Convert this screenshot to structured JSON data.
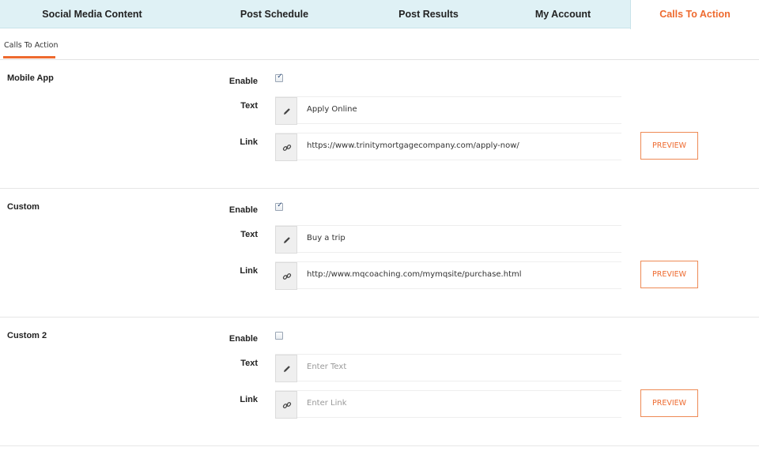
{
  "topnav": {
    "tabs": [
      {
        "label": "Social Media Content"
      },
      {
        "label": "Post Schedule"
      },
      {
        "label": "Post Results"
      },
      {
        "label": "My Account"
      },
      {
        "label": "Calls To Action"
      }
    ],
    "active_tab": "Calls To Action"
  },
  "subtabs": {
    "active": "Calls To Action"
  },
  "labels": {
    "enable": "Enable",
    "text": "Text",
    "link": "Link",
    "preview": "PREVIEW"
  },
  "sections": [
    {
      "title": "Mobile App",
      "enabled": true,
      "text_value": "Apply Online",
      "text_placeholder": "",
      "link_value": "https://www.trinitymortgagecompany.com/apply-now/",
      "link_placeholder": ""
    },
    {
      "title": "Custom",
      "enabled": true,
      "text_value": "Buy a trip",
      "text_placeholder": "",
      "link_value": "http://www.mqcoaching.com/mymqsite/purchase.html",
      "link_placeholder": ""
    },
    {
      "title": "Custom 2",
      "enabled": false,
      "text_value": "Enter Text",
      "text_placeholder": "Enter Text",
      "link_value": "Enter Link",
      "link_placeholder": "Enter Link"
    }
  ],
  "icons": {
    "text_field": "pencil-icon",
    "link_field": "link-icon"
  },
  "colors": {
    "accent": "#ee6a2f",
    "nav_bg": "#dff1f5",
    "checkbox_tick": "#2a4a7a"
  }
}
